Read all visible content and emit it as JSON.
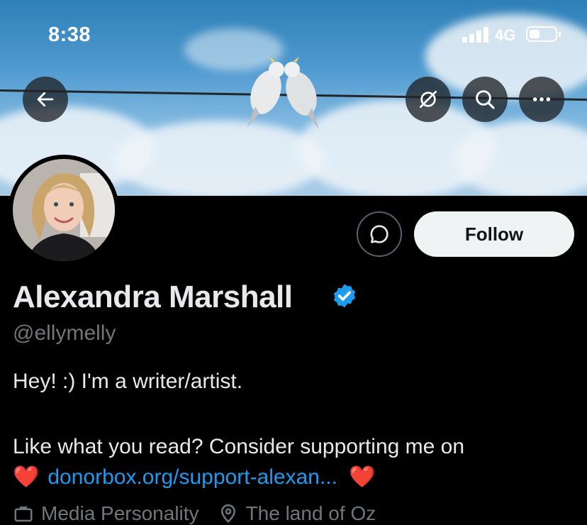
{
  "status_bar": {
    "time": "8:38",
    "network": "4G",
    "battery_level": 0.4
  },
  "header": {
    "back_icon": "arrow-left-icon",
    "actions": [
      "hide-icon",
      "search-icon",
      "more-icon"
    ]
  },
  "profile": {
    "name": "Alexandra Marshall",
    "verified": true,
    "handle": "@ellymelly",
    "follow_label": "Follow",
    "message_icon": "message-icon",
    "bio_line1": "Hey! :) I'm a writer/artist.",
    "bio_line2": "Like what you read? Consider supporting me on",
    "bio_heart": "❤️",
    "bio_link": "donorbox.org/support-alexan...",
    "category": "Media Personality",
    "location": "The land of Oz"
  },
  "colors": {
    "accent": "#1d9bf0",
    "background": "#000000",
    "secondary_text": "#71767b"
  }
}
